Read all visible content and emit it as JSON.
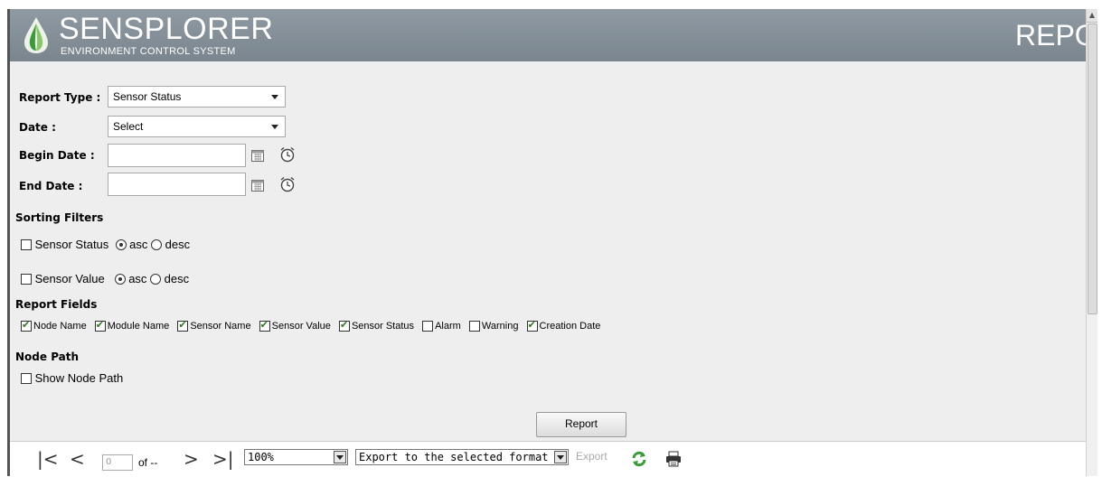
{
  "header": {
    "brand": "SENSPLORER",
    "tagline": "ENVIRONMENT CONTROL SYSTEM",
    "page_title": "REPORTS"
  },
  "form": {
    "report_type_label": "Report Type :",
    "report_type_value": "Sensor Status",
    "date_label": "Date :",
    "date_value": "Select",
    "begin_date_label": "Begin Date :",
    "begin_date_value": "",
    "end_date_label": "End Date :",
    "end_date_value": ""
  },
  "sorting": {
    "title": "Sorting Filters",
    "filters": [
      {
        "label": "Sensor Status",
        "checked": false,
        "asc_label": "asc",
        "desc_label": "desc",
        "order": "asc"
      },
      {
        "label": "Sensor Value",
        "checked": false,
        "asc_label": "asc",
        "desc_label": "desc",
        "order": "asc"
      }
    ]
  },
  "report_fields": {
    "title": "Report Fields",
    "items": [
      {
        "label": "Node Name",
        "checked": true
      },
      {
        "label": "Module Name",
        "checked": true
      },
      {
        "label": "Sensor Name",
        "checked": true
      },
      {
        "label": "Sensor Value",
        "checked": true
      },
      {
        "label": "Sensor Status",
        "checked": true
      },
      {
        "label": "Alarm",
        "checked": false
      },
      {
        "label": "Warning",
        "checked": false
      },
      {
        "label": "Creation Date",
        "checked": true
      }
    ]
  },
  "node_path": {
    "title": "Node Path",
    "show_label": "Show Node Path",
    "checked": false
  },
  "report_button": "Report",
  "toolbar": {
    "page_value": "0",
    "of_label": "of --",
    "zoom": "100%",
    "export_format": "Export to the selected format",
    "export_label": "Export"
  },
  "colors": {
    "header_bg": "#7f8a93",
    "panel_bg": "#eeeeee",
    "check_green": "#2b7a1a"
  }
}
